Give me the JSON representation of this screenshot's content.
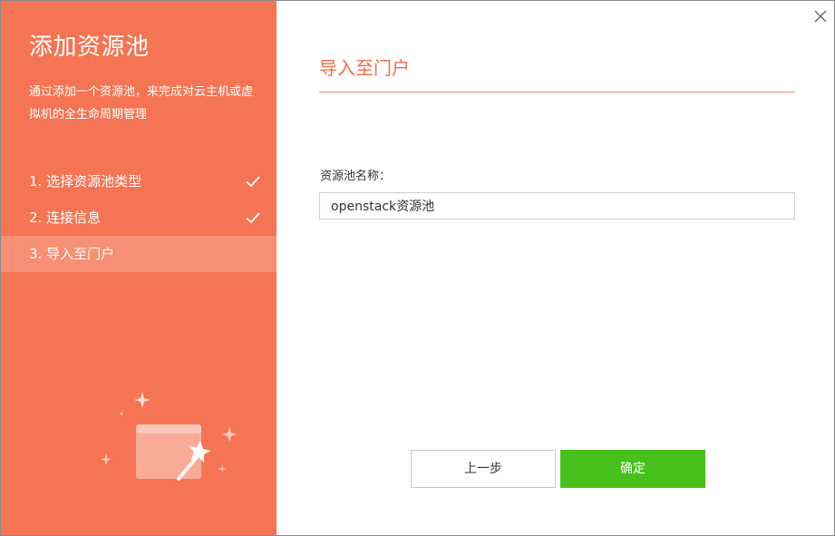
{
  "sidebar": {
    "title": "添加资源池",
    "description": "通过添加一个资源池，来完成对云主机或虚拟机的全生命周期管理",
    "steps": [
      {
        "label": "1. 选择资源池类型",
        "done": true
      },
      {
        "label": "2. 连接信息",
        "done": true
      },
      {
        "label": "3. 导入至门户",
        "done": false
      }
    ]
  },
  "main": {
    "section_title": "导入至门户",
    "pool_name_label": "资源池名称：",
    "pool_name_value": "openstack资源池"
  },
  "footer": {
    "prev_label": "上一步",
    "confirm_label": "确定"
  },
  "icons": {
    "close": "close-icon",
    "check": "check-icon",
    "illustration": "magic-wand-window-icon"
  },
  "colors": {
    "sidebar_bg": "#f57453",
    "accent": "#ef6d4c",
    "confirm_bg": "#47c01b"
  }
}
